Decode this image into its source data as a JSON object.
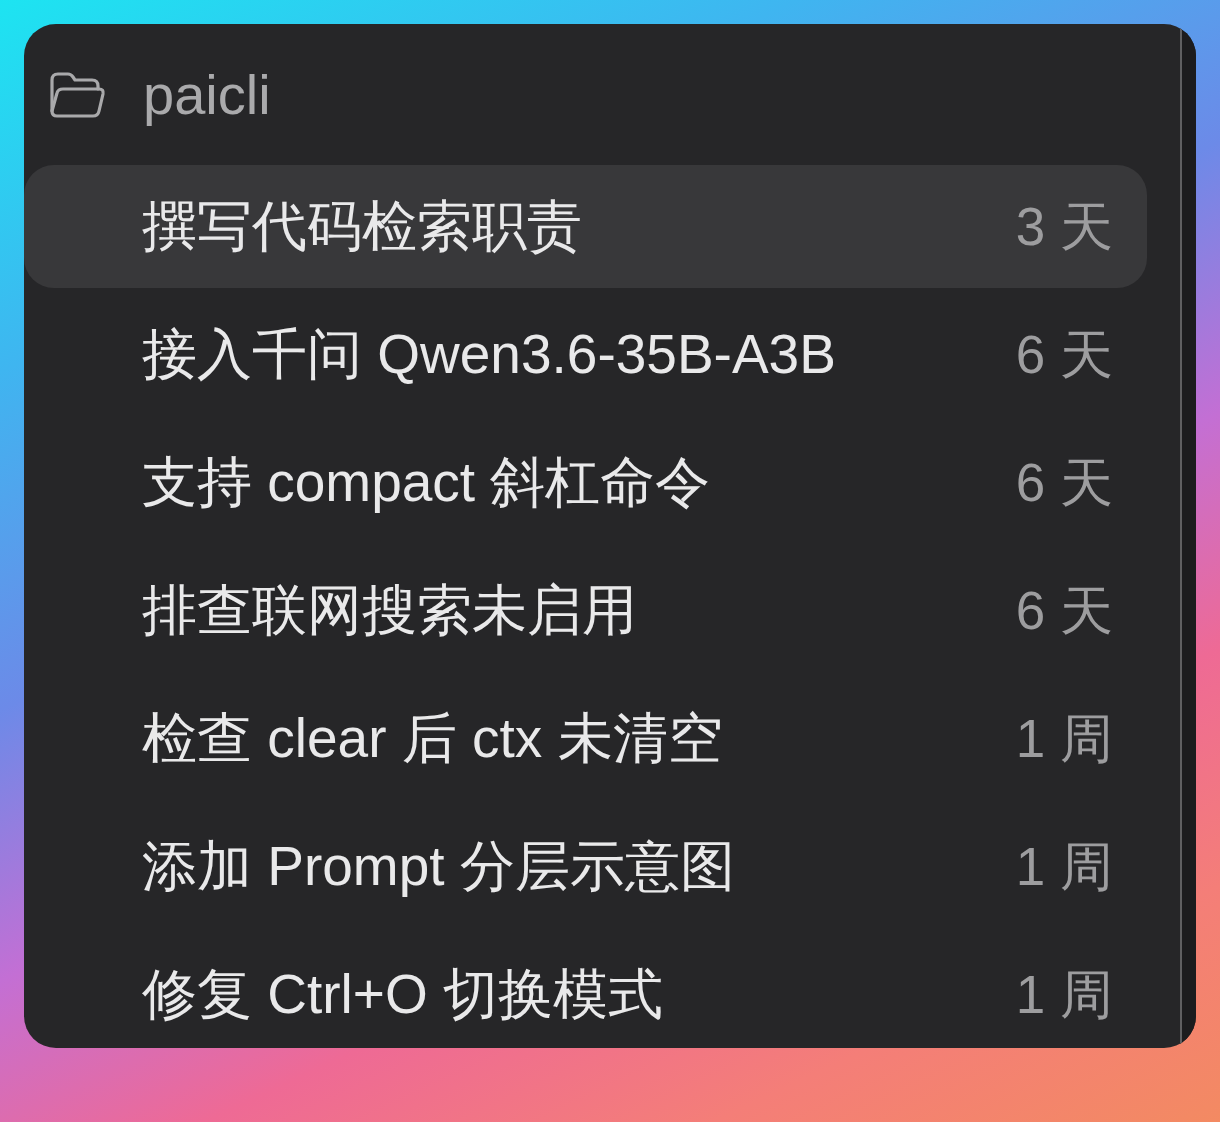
{
  "sidebar": {
    "folder": {
      "name": "paicli"
    },
    "items": [
      {
        "title": "撰写代码检索职责",
        "age": "3 天",
        "selected": true
      },
      {
        "title": "接入千问 Qwen3.6-35B-A3B",
        "age": "6 天",
        "selected": false
      },
      {
        "title": "支持 compact 斜杠命令",
        "age": "6 天",
        "selected": false
      },
      {
        "title": "排查联网搜索未启用",
        "age": "6 天",
        "selected": false
      },
      {
        "title": "检查 clear 后 ctx 未清空",
        "age": "1 周",
        "selected": false
      },
      {
        "title": "添加 Prompt 分层示意图",
        "age": "1 周",
        "selected": false
      },
      {
        "title": "修复 Ctrl+O 切换模式",
        "age": "1 周",
        "selected": false
      }
    ]
  }
}
